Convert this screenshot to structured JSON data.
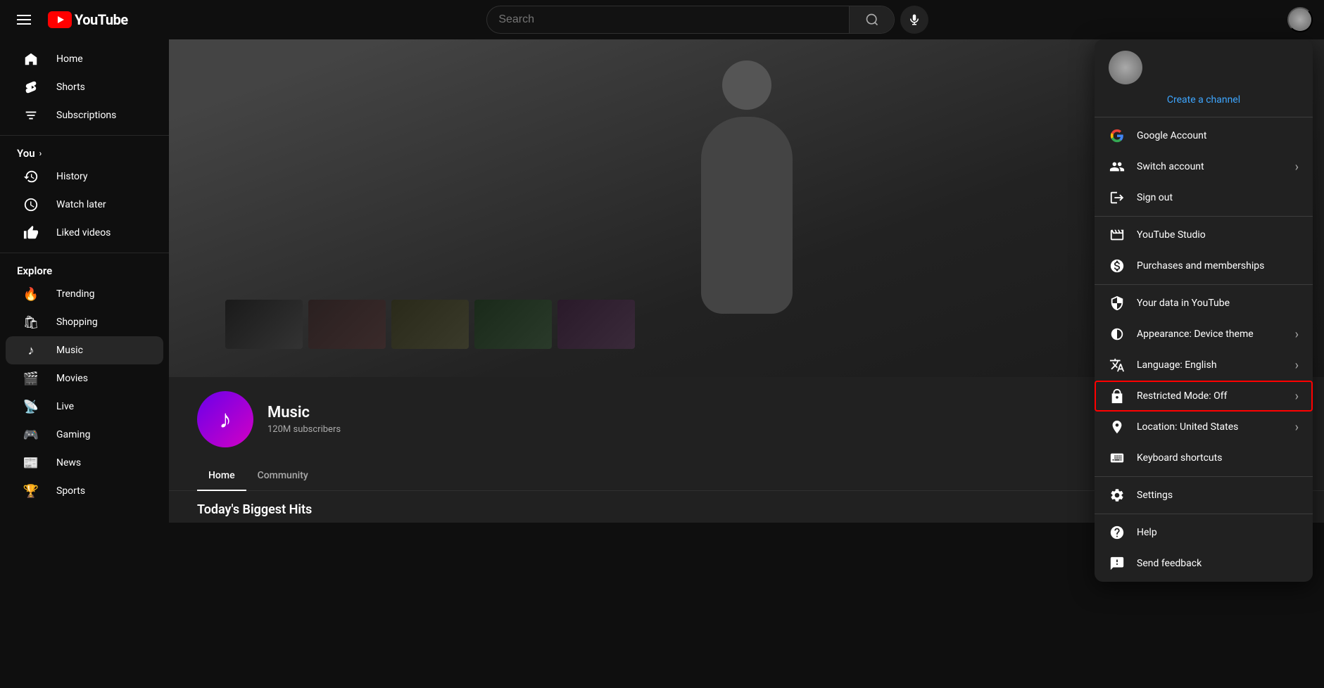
{
  "topnav": {
    "search_placeholder": "Search",
    "youtube_label": "YouTube"
  },
  "sidebar": {
    "items": [
      {
        "id": "home",
        "label": "Home",
        "icon": "⌂"
      },
      {
        "id": "shorts",
        "label": "Shorts",
        "icon": "▶"
      },
      {
        "id": "subscriptions",
        "label": "Subscriptions",
        "icon": "📺"
      },
      {
        "id": "you_section",
        "label": "You",
        "has_chevron": true
      },
      {
        "id": "history",
        "label": "History",
        "icon": "🕐"
      },
      {
        "id": "watch-later",
        "label": "Watch later",
        "icon": "⏰"
      },
      {
        "id": "liked-videos",
        "label": "Liked videos",
        "icon": "👍"
      },
      {
        "id": "explore_section",
        "label": "Explore"
      },
      {
        "id": "trending",
        "label": "Trending",
        "icon": "🔥"
      },
      {
        "id": "shopping",
        "label": "Shopping",
        "icon": "🛍"
      },
      {
        "id": "music",
        "label": "Music",
        "icon": "♪"
      },
      {
        "id": "movies",
        "label": "Movies",
        "icon": "🎬"
      },
      {
        "id": "live",
        "label": "Live",
        "icon": "📡"
      },
      {
        "id": "gaming",
        "label": "Gaming",
        "icon": "🎮"
      },
      {
        "id": "news",
        "label": "News",
        "icon": "📰"
      },
      {
        "id": "sports",
        "label": "Sports",
        "icon": "🏆"
      }
    ]
  },
  "channel": {
    "name": "Music",
    "subscribers": "120M subscribers",
    "avatar_emoji": "♪",
    "tabs": [
      {
        "id": "home",
        "label": "Home",
        "active": true
      },
      {
        "id": "community",
        "label": "Community",
        "active": false
      }
    ],
    "section_title": "Today's Biggest Hits",
    "thumbnails": [
      "",
      "",
      "",
      "",
      ""
    ]
  },
  "dropdown": {
    "user_name": "",
    "user_handle": "",
    "create_channel_label": "Create a channel",
    "sections": [
      {
        "items": [
          {
            "id": "google-account",
            "label": "Google Account",
            "icon": "G",
            "icon_type": "google",
            "has_chevron": false
          },
          {
            "id": "switch-account",
            "label": "Switch account",
            "icon": "👤",
            "has_chevron": true
          },
          {
            "id": "sign-out",
            "label": "Sign out",
            "icon": "→",
            "has_chevron": false
          }
        ]
      },
      {
        "items": [
          {
            "id": "youtube-studio",
            "label": "YouTube Studio",
            "icon": "🎬",
            "has_chevron": false
          },
          {
            "id": "purchases",
            "label": "Purchases and memberships",
            "icon": "💰",
            "has_chevron": false
          }
        ]
      },
      {
        "items": [
          {
            "id": "your-data",
            "label": "Your data in YouTube",
            "icon": "🛡",
            "has_chevron": false
          },
          {
            "id": "appearance",
            "label": "Appearance: Device theme",
            "icon": "◐",
            "has_chevron": true
          },
          {
            "id": "language",
            "label": "Language: English",
            "icon": "A",
            "icon_type": "translate",
            "has_chevron": true
          },
          {
            "id": "restricted-mode",
            "label": "Restricted Mode: Off",
            "icon": "🔒",
            "has_chevron": true,
            "highlighted": true
          },
          {
            "id": "location",
            "label": "Location: United States",
            "icon": "🌐",
            "has_chevron": true
          },
          {
            "id": "keyboard-shortcuts",
            "label": "Keyboard shortcuts",
            "icon": "⌨",
            "has_chevron": false
          }
        ]
      },
      {
        "items": [
          {
            "id": "settings",
            "label": "Settings",
            "icon": "⚙",
            "has_chevron": false
          }
        ]
      },
      {
        "items": [
          {
            "id": "help",
            "label": "Help",
            "icon": "?",
            "has_chevron": false
          },
          {
            "id": "send-feedback",
            "label": "Send feedback",
            "icon": "!",
            "has_chevron": false
          }
        ]
      }
    ]
  }
}
